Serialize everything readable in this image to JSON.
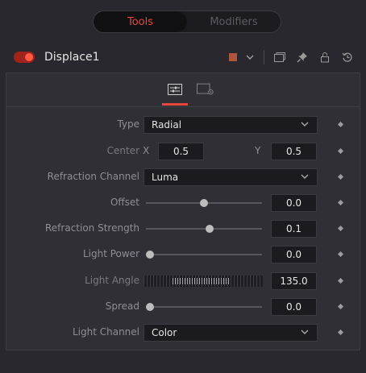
{
  "top_tabs": {
    "tools": "Tools",
    "modifiers": "Modifiers"
  },
  "tool": {
    "name": "Displace1",
    "enabled": true,
    "swatch_color": "#b0553a"
  },
  "header_icons": [
    "color-swatch-dropdown",
    "window-icon",
    "pin-icon",
    "lock-icon",
    "reset-icon"
  ],
  "panel_tabs": [
    "controls-tab-icon",
    "settings-tab-icon"
  ],
  "controls": {
    "type": {
      "label": "Type",
      "value": "Radial"
    },
    "center": {
      "label": "Center",
      "x_label": "X",
      "x_value": "0.5",
      "y_label": "Y",
      "y_value": "0.5"
    },
    "refraction_channel": {
      "label": "Refraction Channel",
      "value": "Luma"
    },
    "offset": {
      "label": "Offset",
      "value": "0.0",
      "slider_fraction": 0.5
    },
    "refraction_strength": {
      "label": "Refraction Strength",
      "value": "0.1",
      "slider_fraction": 0.55
    },
    "light_power": {
      "label": "Light Power",
      "value": "0.0",
      "slider_fraction": 0.0
    },
    "light_angle": {
      "label": "Light Angle",
      "value": "135.0"
    },
    "spread": {
      "label": "Spread",
      "value": "0.0",
      "slider_fraction": 0.0
    },
    "light_channel": {
      "label": "Light Channel",
      "value": "Color"
    }
  },
  "colors": {
    "accent": "#e8453c",
    "background": "#28282e",
    "panel": "#2f2f35"
  }
}
